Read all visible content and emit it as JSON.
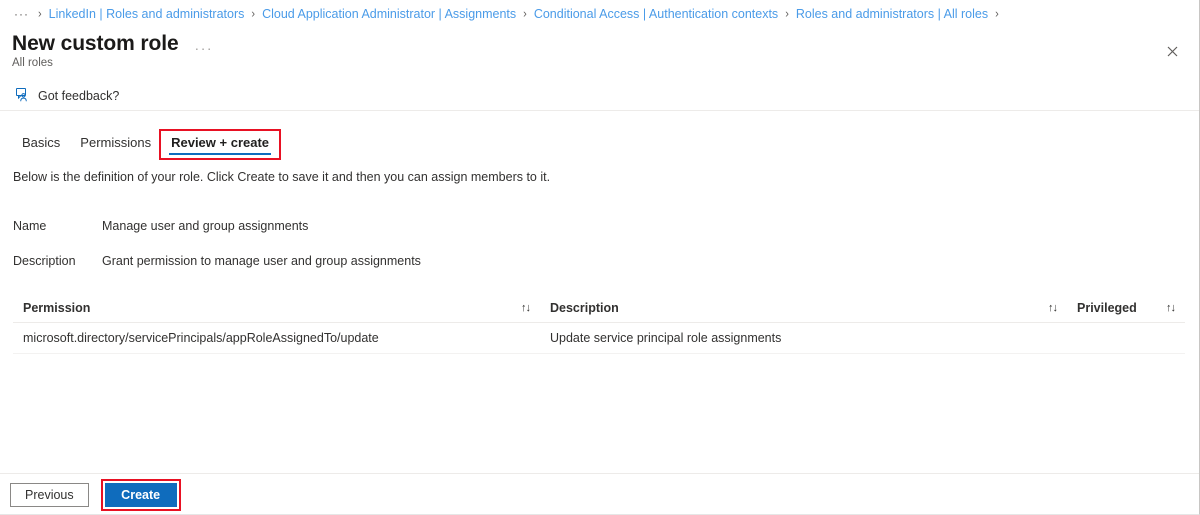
{
  "breadcrumb": {
    "ellipsis": "···",
    "separator": "›",
    "items": [
      "LinkedIn | Roles and administrators",
      "Cloud Application Administrator | Assignments",
      "Conditional Access | Authentication contexts",
      "Roles and administrators | All roles"
    ]
  },
  "header": {
    "title": "New custom role",
    "subtitle": "All roles",
    "menu_ellipsis": "···",
    "close_label": "✕"
  },
  "commandbar": {
    "feedback_label": "Got feedback?",
    "feedback_icon": "feedback-person-icon"
  },
  "tabs": [
    {
      "label": "Basics",
      "selected": false
    },
    {
      "label": "Permissions",
      "selected": false
    },
    {
      "label": "Review + create",
      "selected": true,
      "highlighted": true
    }
  ],
  "main": {
    "intro": "Below is the definition of your role. Click Create to save it and then you can assign members to it.",
    "fields": [
      {
        "label": "Name",
        "value": "Manage user and group assignments"
      },
      {
        "label": "Description",
        "value": "Grant permission to manage user and group assignments"
      }
    ],
    "table": {
      "columns": [
        {
          "label": "Permission",
          "sort_icon": "↑↓"
        },
        {
          "label": "Description",
          "sort_icon": "↑↓"
        },
        {
          "label": "Privileged",
          "sort_icon": "↑↓"
        }
      ],
      "rows": [
        {
          "permission": "microsoft.directory/servicePrincipals/appRoleAssignedTo/update",
          "description": "Update service principal role assignments",
          "privileged": ""
        }
      ]
    }
  },
  "footer": {
    "previous_label": "Previous",
    "create_label": "Create"
  },
  "colors": {
    "accent": "#0f6cbd",
    "link": "#4a9be8",
    "highlight": "#e81123",
    "text": "#323130",
    "divider": "#edebe9"
  }
}
